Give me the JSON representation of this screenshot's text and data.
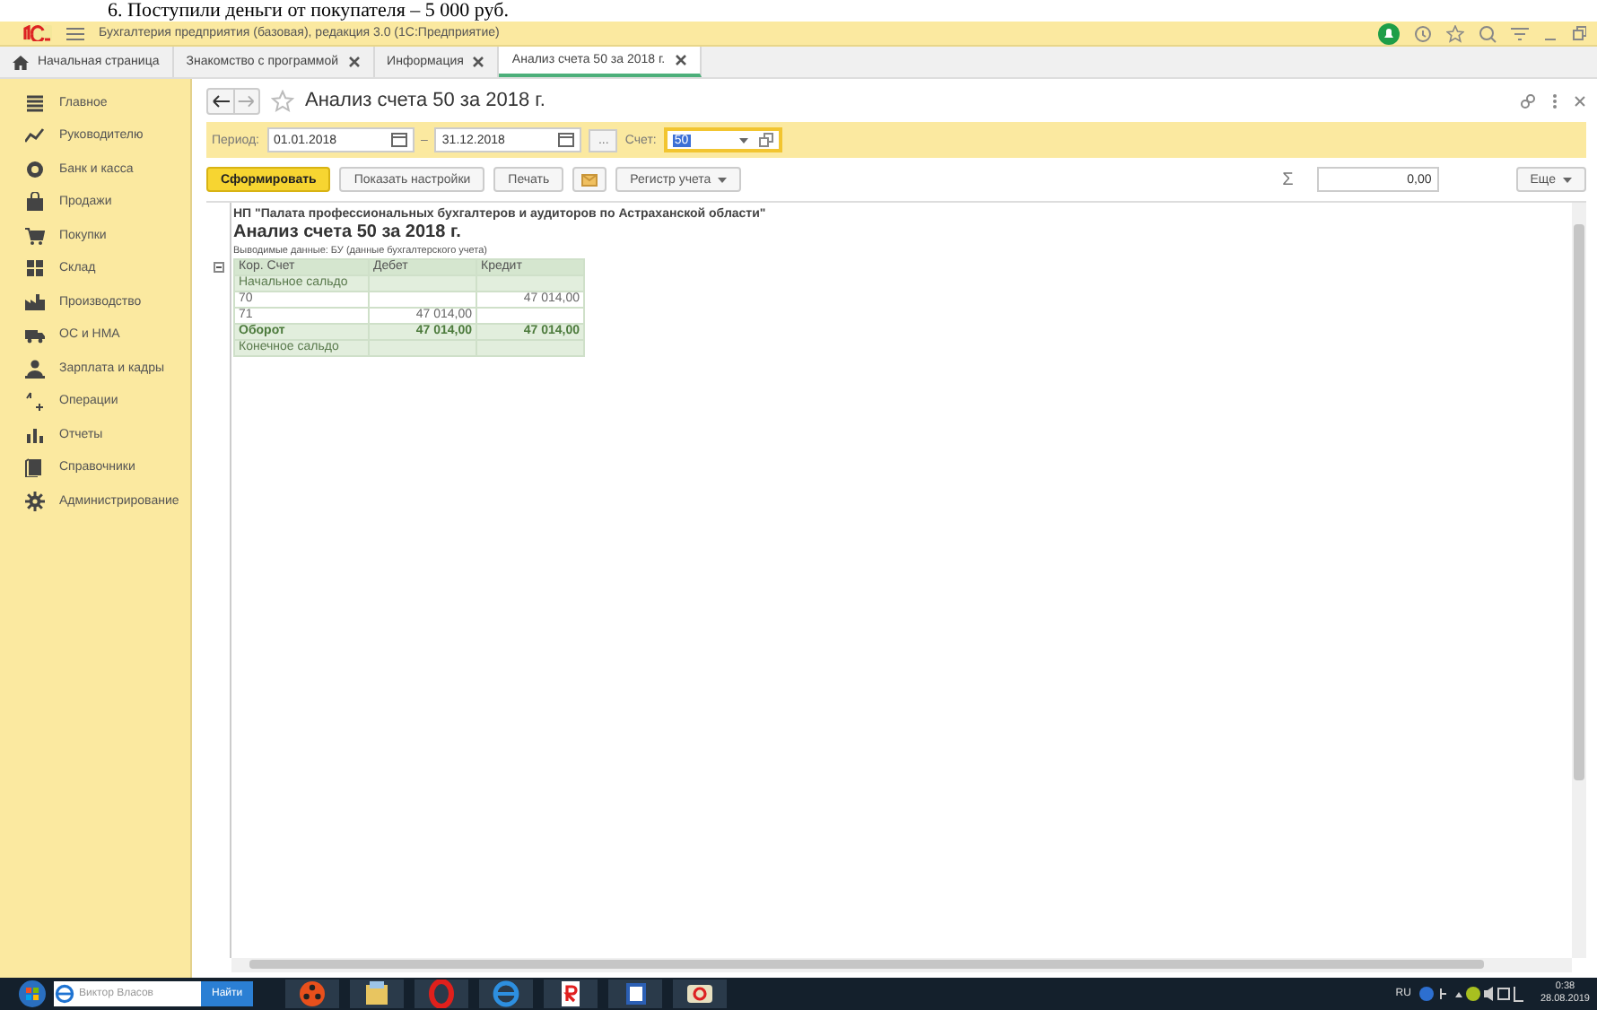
{
  "document_text": "6. Поступили деньги от покупателя – 5 000 руб.",
  "window": {
    "title": "Бухгалтерия предприятия (базовая), редакция 3.0  (1С:Предприятие)"
  },
  "tabs": [
    {
      "kind": "home",
      "label": "Начальная страница",
      "selected": false
    },
    {
      "kind": "document",
      "label": "Знакомство с программой",
      "selected": false
    },
    {
      "kind": "document",
      "label": "Информация",
      "selected": false
    },
    {
      "kind": "document",
      "label": "Анализ счета 50 за 2018 г.",
      "selected": true
    }
  ],
  "sidebar": {
    "items": [
      {
        "label": "Главное"
      },
      {
        "label": "Руководителю"
      },
      {
        "label": "Банк и касса"
      },
      {
        "label": "Продажи"
      },
      {
        "label": "Покупки"
      },
      {
        "label": "Склад"
      },
      {
        "label": "Производство"
      },
      {
        "label": "ОС и НМА"
      },
      {
        "label": "Зарплата и кадры"
      },
      {
        "label": "Операции"
      },
      {
        "label": "Отчеты"
      },
      {
        "label": "Справочники"
      },
      {
        "label": "Администрирование"
      }
    ]
  },
  "form": {
    "title": "Анализ счета 50 за 2018 г.",
    "filters": {
      "period_label": "Период:",
      "date_from": "01.01.2018",
      "dash": "–",
      "date_to": "31.12.2018",
      "dots": "...",
      "account_label": "Счет:",
      "account": "50"
    },
    "toolbar": {
      "primary": "Сформировать",
      "buttons": [
        "Показать настройки",
        "Печать"
      ],
      "register": "Регистр учета",
      "sum_sign": "Σ",
      "sum": "0,00",
      "more": "Еще"
    },
    "report": {
      "organization": "НП \"Палата профессиональных бухгалтеров и аудиторов по Астраханской области\"",
      "title": "Анализ счета 50 за 2018 г.",
      "output": "Выводимые данные:  БУ (данные бухгалтерского учета)",
      "columns": [
        "Кор. Счет",
        "Дебет",
        "Кредит"
      ],
      "rows": [
        {
          "kind": "group",
          "cells": [
            "Начальное сальдо",
            "",
            ""
          ]
        },
        {
          "kind": "detail",
          "cells": [
            "70",
            "",
            "47 014,00"
          ]
        },
        {
          "kind": "detail",
          "cells": [
            "71",
            "47 014,00",
            ""
          ]
        },
        {
          "kind": "total",
          "cells": [
            "Оборот",
            "47 014,00",
            "47 014,00"
          ]
        },
        {
          "kind": "group",
          "cells": [
            "Конечное сальдо",
            "",
            ""
          ]
        }
      ]
    }
  },
  "taskbar": {
    "search_placeholder": "Виктор Власов",
    "search_button": "Найти",
    "language": "RU",
    "time": "0:38",
    "date": "28.08.2019"
  }
}
